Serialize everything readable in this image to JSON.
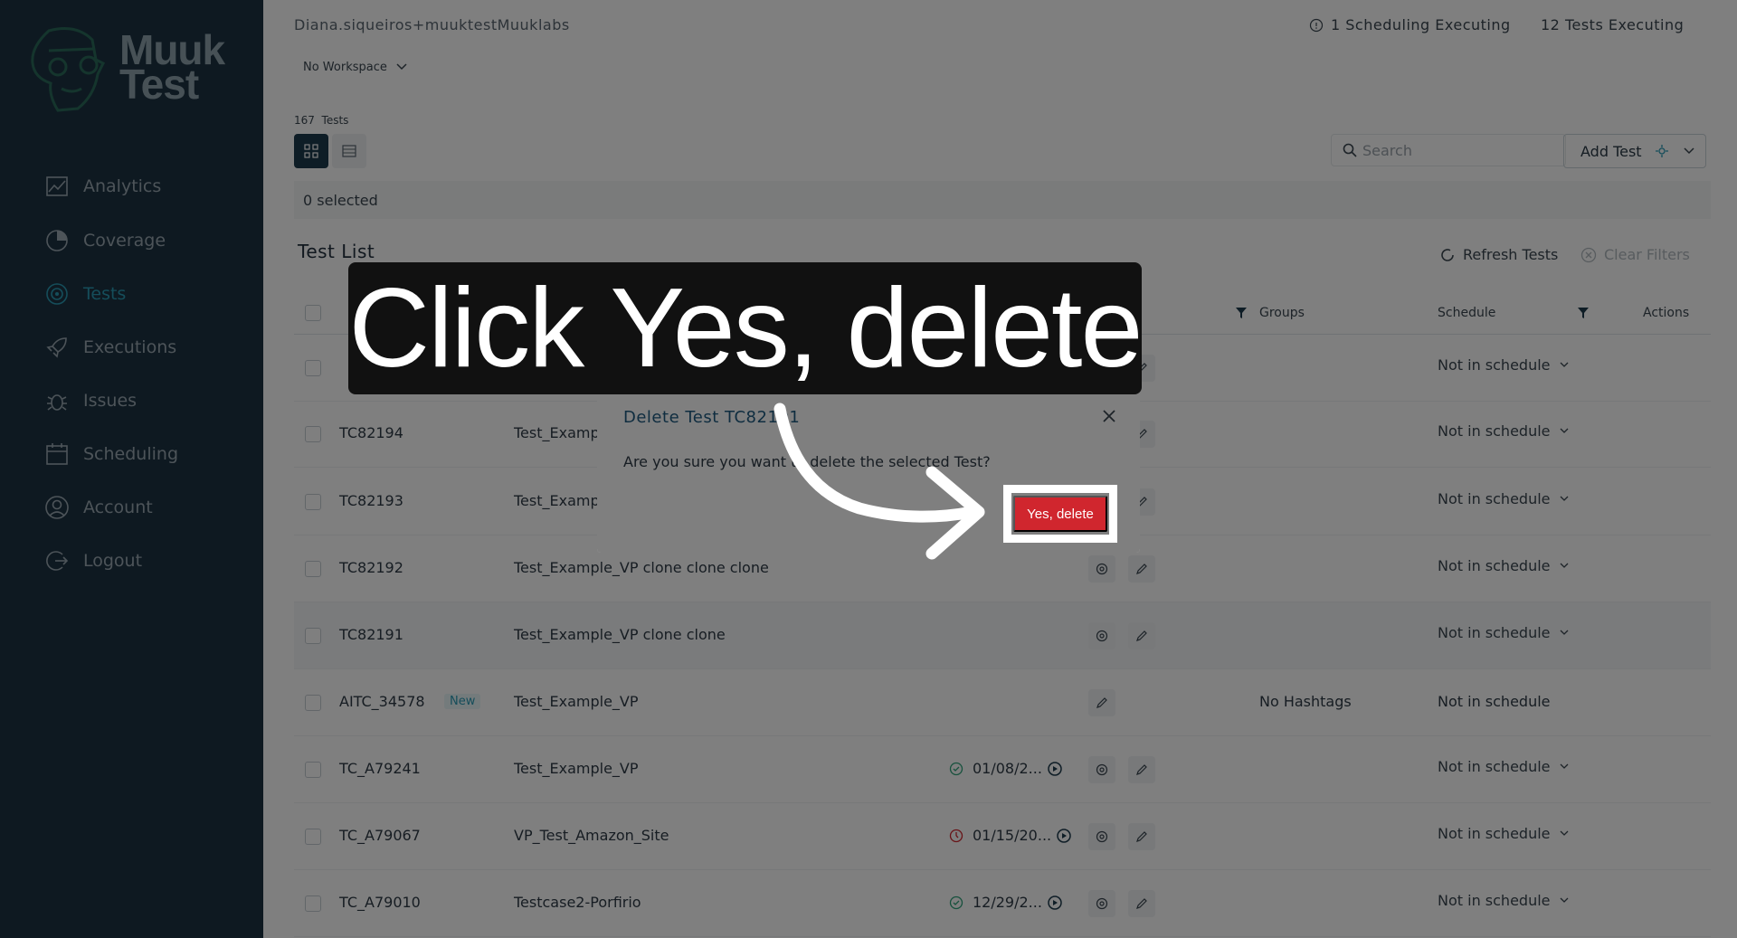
{
  "sidebar": {
    "logo_text": "Muuk Test",
    "items": [
      {
        "label": "Analytics",
        "icon": "analytics-icon"
      },
      {
        "label": "Coverage",
        "icon": "coverage-icon"
      },
      {
        "label": "Tests",
        "icon": "tests-icon",
        "active": true
      },
      {
        "label": "Executions",
        "icon": "rocket-icon"
      },
      {
        "label": "Issues",
        "icon": "bug-icon"
      },
      {
        "label": "Scheduling",
        "icon": "calendar-icon"
      },
      {
        "label": "Account",
        "icon": "user-icon"
      },
      {
        "label": "Logout",
        "icon": "logout-icon"
      }
    ]
  },
  "header": {
    "user": "Diana.siqueiros+muuktestMuuklabs",
    "scheduling_status": "1 Scheduling Executing",
    "tests_status": "12 Tests Executing",
    "workspace": "No Workspace"
  },
  "toolbar": {
    "count_number": "167",
    "count_label": "Tests",
    "search_placeholder": "Search",
    "add_test_label": "Add Test",
    "selected_text": "0 selected"
  },
  "list": {
    "title": "Test List",
    "refresh_label": "Refresh Tests",
    "clear_label": "Clear Filters",
    "headers": {
      "groups": "Groups",
      "schedule": "Schedule",
      "actions": "Actions"
    },
    "rows": [
      {
        "id": "TC82194",
        "name": "Test_Examp",
        "schedule": "Not in schedule"
      },
      {
        "id": "TC82193",
        "name": "Test_Examp",
        "schedule": "Not in schedule"
      },
      {
        "id": "TC82192",
        "name": "Test_Example_VP clone clone clone",
        "schedule": "Not in schedule"
      },
      {
        "id": "TC82191",
        "name": "Test_Example_VP clone clone",
        "schedule": "Not in schedule"
      },
      {
        "id": "AITC_34578",
        "badge": "New",
        "name": "Test_Example_VP",
        "groups": "No Hashtags",
        "schedule": "Not in schedule"
      },
      {
        "id": "TC_A79241",
        "name": "Test_Example_VP",
        "exec_date": "01/08/2...",
        "exec_status": "success",
        "schedule": "Not in schedule"
      },
      {
        "id": "TC_A79067",
        "name": "VP_Test_Amazon_Site",
        "exec_date": "01/15/20...",
        "exec_status": "error",
        "schedule": "Not in schedule"
      },
      {
        "id": "TC_A79010",
        "name": "Testcase2-Porfirio",
        "exec_date": "12/29/2...",
        "exec_status": "success",
        "schedule": "Not in schedule"
      }
    ]
  },
  "modal": {
    "title": "Delete Test TC82191",
    "message": "Are you sure you want to delete the selected Test?",
    "confirm_label": "Yes, delete"
  },
  "instruction": {
    "text": "Click Yes, delete"
  },
  "colors": {
    "sidebar_bg": "#1c3343",
    "accent": "#2a9bb5",
    "danger": "#d0262e",
    "modal_title": "#1e5a80"
  }
}
